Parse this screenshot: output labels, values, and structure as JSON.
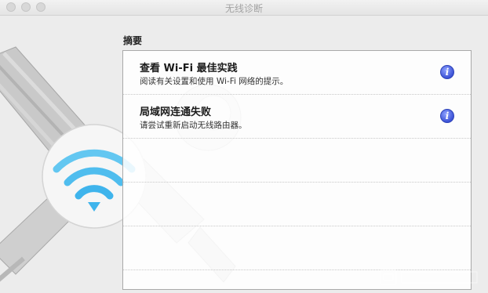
{
  "window": {
    "title": "无线诊断"
  },
  "summary": {
    "label": "摘要",
    "items": [
      {
        "title": "查看 Wi-Fi 最佳实践",
        "description": "阅读有关设置和使用 Wi-Fi 网络的提示。",
        "icon": "info-icon"
      },
      {
        "title": "局域网连通失败",
        "description": "请尝试重新启动无线路由器。",
        "icon": "info-icon"
      }
    ]
  },
  "colors": {
    "info_blue": "#3c52d6",
    "wifi_blue": "#3fb4ec"
  }
}
